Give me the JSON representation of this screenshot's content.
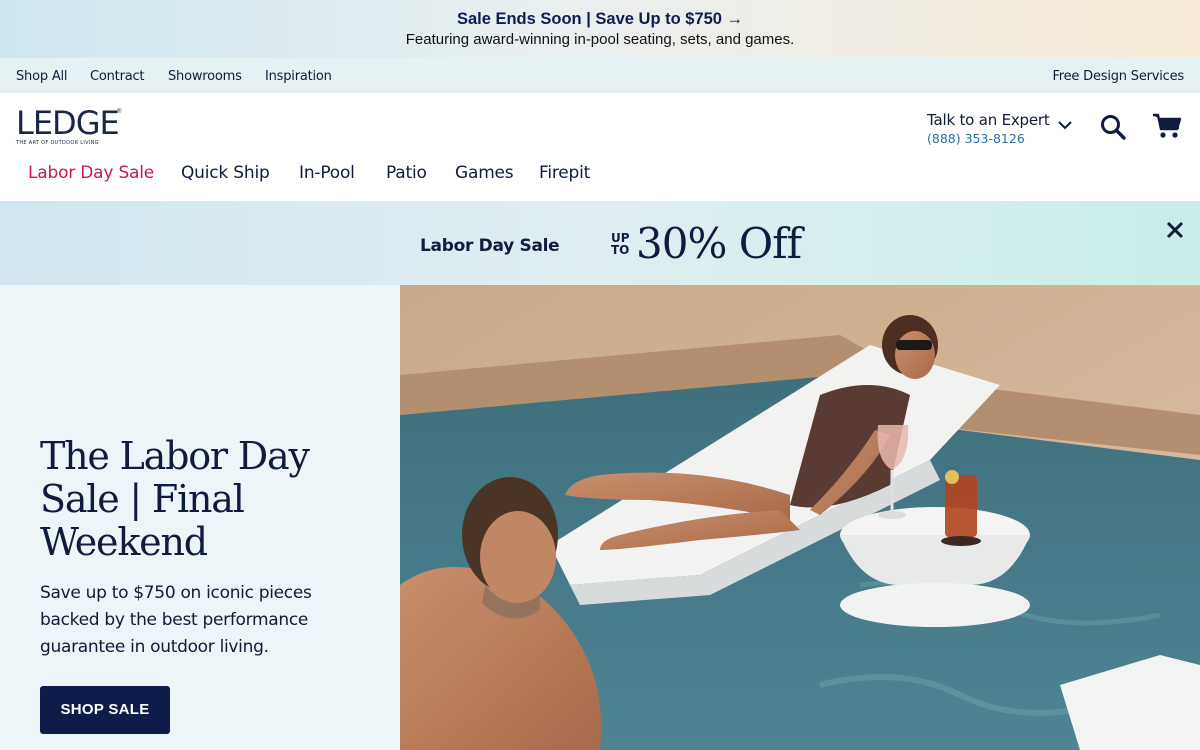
{
  "promo": {
    "title": "Sale Ends Soon | Save Up to $750 →",
    "subtitle": "Featuring award-winning in-pool seating, sets, and games."
  },
  "utility_nav": {
    "items": [
      "Shop All",
      "Contract",
      "Showrooms",
      "Inspiration"
    ],
    "right_link": "Free Design Services"
  },
  "header": {
    "logo": "LEDGE",
    "logo_tagline": "THE ART OF OUTDOOR LIVING",
    "expert_label": "Talk to an Expert",
    "expert_phone": "(888) 353-8126",
    "nav": [
      "Labor Day Sale",
      "Quick Ship",
      "In-Pool",
      "Patio",
      "Games",
      "Firepit"
    ]
  },
  "banner": {
    "label": "Labor Day Sale",
    "up": "UP",
    "to": "TO",
    "offer": "30% Off"
  },
  "hero": {
    "title": "The Labor Day Sale | Final Weekend",
    "body": "Save up to $750 on iconic pieces backed by the best performance guarantee in outdoor living.",
    "cta": "SHOP SALE"
  },
  "colors": {
    "navy": "#0f1c3f",
    "sale_accent": "#c2185b",
    "phone_link": "#2a6ea8",
    "button_bg": "#0f1c4a"
  }
}
